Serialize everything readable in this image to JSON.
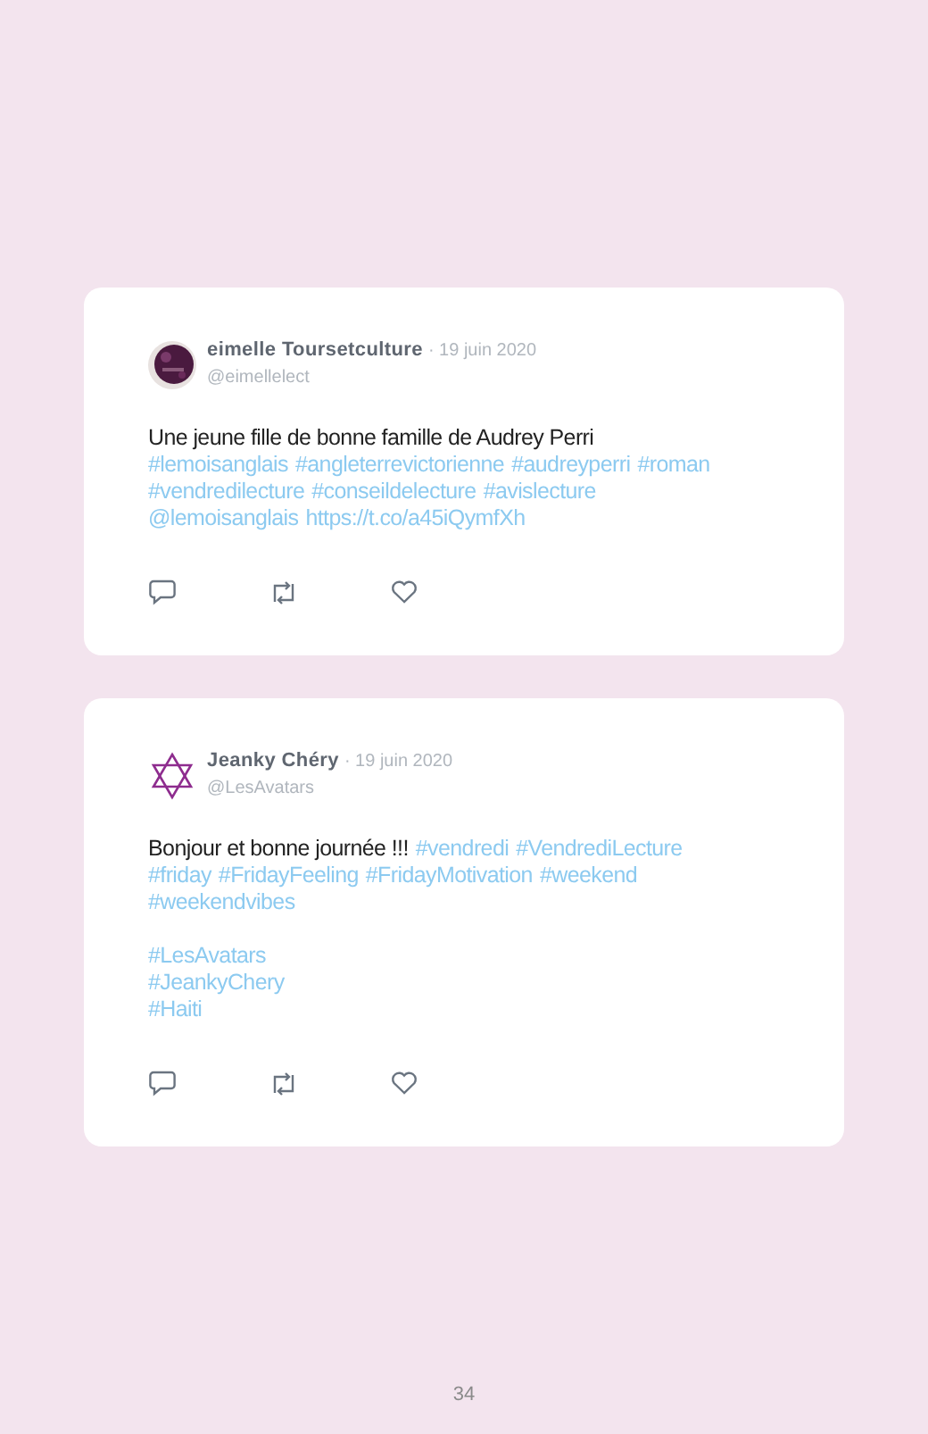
{
  "tweets": [
    {
      "avatar": {
        "kind": "picture"
      },
      "name": "eimelle Toursetculture",
      "date": "· 19 juin 2020",
      "handle": "@eimellelect",
      "paragraphs": [
        [
          [
            {
              "kind": "text",
              "text": "Une jeune fille de bonne famille de Audrey Perri"
            }
          ],
          [
            {
              "kind": "hashtag",
              "text": "#lemoisanglais"
            },
            {
              "kind": "hashtag",
              "text": "#angleterrevictorienne"
            },
            {
              "kind": "hashtag",
              "text": "#audreyperri"
            },
            {
              "kind": "hashtag",
              "text": "#roman"
            }
          ],
          [
            {
              "kind": "hashtag",
              "text": "#vendredilecture"
            },
            {
              "kind": "hashtag",
              "text": "#conseildelecture"
            },
            {
              "kind": "hashtag",
              "text": "#avislecture"
            }
          ],
          [
            {
              "kind": "mention",
              "text": "@lemoisanglais"
            },
            {
              "kind": "url",
              "text": "https://t.co/a45iQymfXh"
            }
          ]
        ]
      ]
    },
    {
      "avatar": {
        "kind": "star"
      },
      "name": "Jeanky Chéry",
      "date": "· 19 juin 2020",
      "handle": "@LesAvatars",
      "paragraphs": [
        [
          [
            {
              "kind": "text",
              "text": "Bonjour et bonne journée !!!"
            },
            {
              "kind": "hashtag",
              "text": "#vendredi"
            },
            {
              "kind": "hashtag",
              "text": "#VendrediLecture"
            }
          ],
          [
            {
              "kind": "hashtag",
              "text": "#friday"
            },
            {
              "kind": "hashtag",
              "text": "#FridayFeeling"
            },
            {
              "kind": "hashtag",
              "text": "#FridayMotivation"
            },
            {
              "kind": "hashtag",
              "text": "#weekend"
            }
          ],
          [
            {
              "kind": "hashtag",
              "text": "#weekendvibes"
            }
          ]
        ],
        [
          [
            {
              "kind": "hashtag",
              "text": "#LesAvatars"
            }
          ],
          [
            {
              "kind": "hashtag",
              "text": "#JeankyChery"
            }
          ],
          [
            {
              "kind": "hashtag",
              "text": "#Haiti"
            }
          ]
        ]
      ]
    }
  ],
  "page_number": "34"
}
